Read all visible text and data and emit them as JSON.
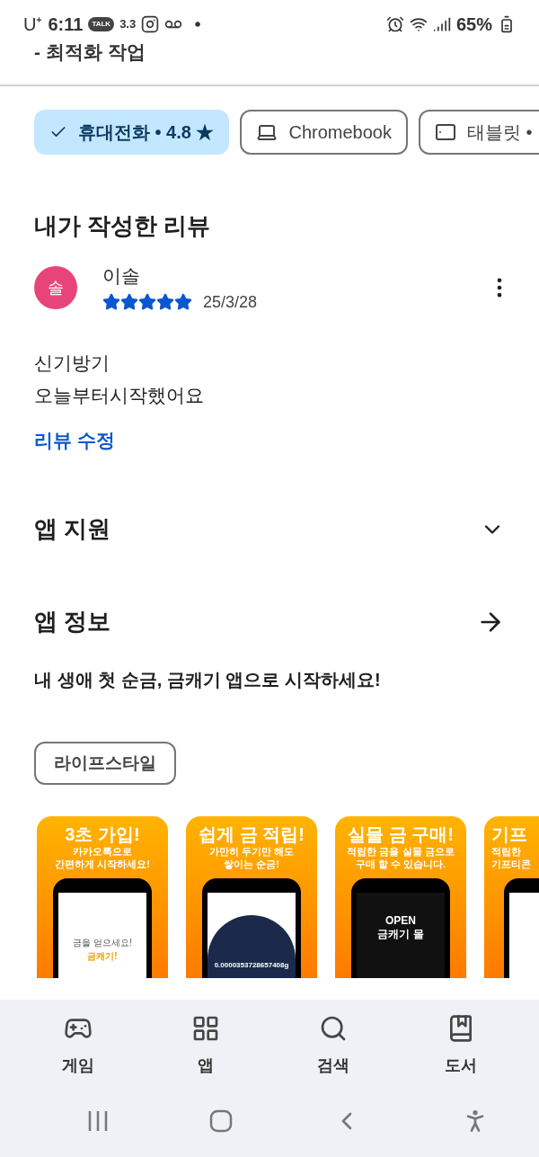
{
  "status_bar": {
    "carrier": "U⁺",
    "time": "6:11",
    "talk_badge": "TALK",
    "weather": "3.3",
    "battery": "65%"
  },
  "header": {
    "title": "- 최적화 작업"
  },
  "devices": [
    {
      "kind": "phone",
      "label": "휴대전화 • 4.8 ★",
      "selected": true
    },
    {
      "kind": "laptop",
      "label": "Chromebook",
      "selected": false
    },
    {
      "kind": "tablet",
      "label": "태블릿 •",
      "selected": false
    }
  ],
  "my_review": {
    "heading": "내가 작성한 리뷰",
    "avatar": "솔",
    "author": "이솔",
    "stars": 5,
    "date": "25/3/28",
    "lines": [
      "신기방기",
      "오늘부터시작했어요"
    ],
    "edit_link": "리뷰 수정"
  },
  "sections": [
    {
      "kind": "expand",
      "title": "앱 지원"
    },
    {
      "kind": "arrow",
      "title": "앱 정보"
    }
  ],
  "description": "내 생애 첫 순금, 금캐기 앱으로 시작하세요!",
  "category": "라이프스타일",
  "screenshots": [
    {
      "kind": "signup",
      "title": "3초 가입!",
      "subtitle": [
        "카카오톡으로",
        "간편하게 시작하세요!"
      ],
      "screen": [
        "금을 얻으세요!",
        "금캐기!"
      ]
    },
    {
      "kind": "mining",
      "title": "쉽게 금 적립!",
      "subtitle": [
        "가만히 두기만 해도",
        "쌓이는 순금!"
      ],
      "screen": [
        "0.0000353728657408g"
      ]
    },
    {
      "kind": "mall",
      "title": "실물 금 구매!",
      "subtitle": [
        "적립한 금을 실물 금으로",
        "구매 할 수 있습니다."
      ],
      "screen": [
        "OPEN",
        "금캐기 몰"
      ]
    },
    {
      "kind": "gift",
      "title": "기프",
      "subtitle": [
        "적립한",
        "기프티콘"
      ]
    }
  ],
  "bottom_nav": [
    {
      "kind": "games",
      "label": "게임",
      "selected": false
    },
    {
      "kind": "apps",
      "label": "앱",
      "selected": false
    },
    {
      "kind": "search",
      "label": "검색",
      "selected": false
    },
    {
      "kind": "books",
      "label": "도서",
      "selected": false
    }
  ]
}
